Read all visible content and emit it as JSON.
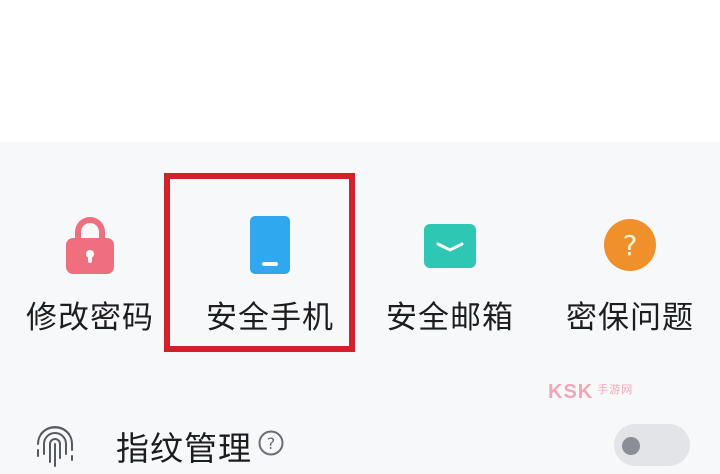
{
  "shortcuts": [
    {
      "label": "修改密码",
      "icon": "lock-icon",
      "color": "#f06f7f"
    },
    {
      "label": "安全手机",
      "icon": "phone-icon",
      "color": "#2fa8ef"
    },
    {
      "label": "安全邮箱",
      "icon": "email-icon",
      "color": "#2ec7b3"
    },
    {
      "label": "密保问题",
      "icon": "question-icon",
      "color": "#f0902a"
    }
  ],
  "highlight_color": "#d3202a",
  "settings_row": {
    "title": "指纹管理",
    "icon": "fingerprint-icon",
    "help_icon": "help-icon",
    "toggle_on": false
  },
  "watermark": {
    "text": "KSK",
    "sub": "手游网"
  }
}
